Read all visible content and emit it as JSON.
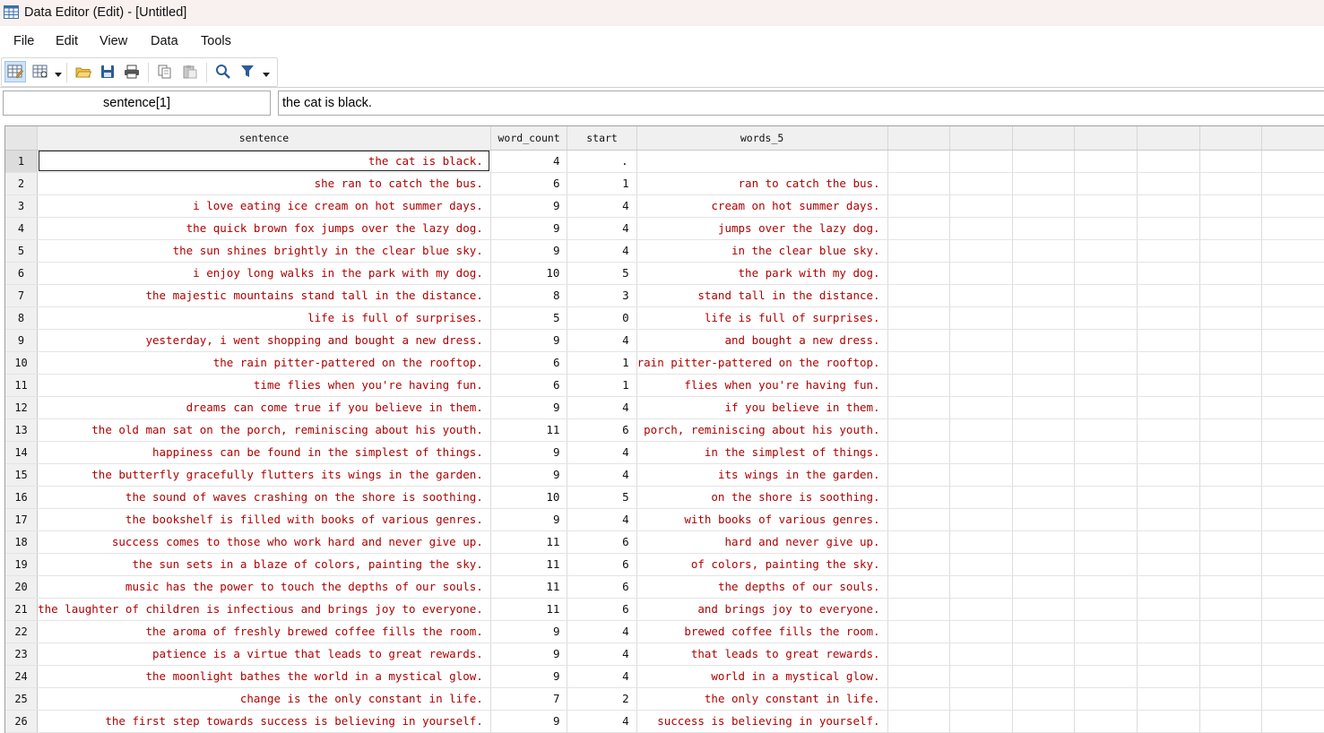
{
  "window": {
    "title": "Data Editor (Edit) - [Untitled]",
    "app_icon": "data-editor-grid-icon"
  },
  "menu": [
    "File",
    "Edit",
    "View",
    "Data",
    "Tools"
  ],
  "toolbar": {
    "buttons": [
      "edit-mode-icon",
      "browse-mode-icon",
      "open-icon",
      "save-icon",
      "print-icon",
      "copy-icon",
      "paste-icon",
      "find-icon",
      "filter-icon"
    ]
  },
  "refbar": {
    "cell_name": "sentence[1]",
    "cell_value": "the cat is black."
  },
  "colors": {
    "string_text": "#b00000",
    "title_bar": "#f9f1ef",
    "selection_outline": "#222222"
  },
  "grid": {
    "columns": [
      "sentence",
      "word_count",
      "start",
      "words_5",
      "",
      "",
      "",
      "",
      "",
      "",
      ""
    ],
    "selected_cell": {
      "row": 1,
      "column": "sentence"
    },
    "rows": [
      {
        "n": "1",
        "sentence": "the cat is black.",
        "word_count": "4",
        "start": ".",
        "words_5": ""
      },
      {
        "n": "2",
        "sentence": "she ran to catch the bus.",
        "word_count": "6",
        "start": "1",
        "words_5": "ran to catch the bus."
      },
      {
        "n": "3",
        "sentence": "i love eating ice cream on hot summer days.",
        "word_count": "9",
        "start": "4",
        "words_5": "cream on hot summer days."
      },
      {
        "n": "4",
        "sentence": "the quick brown fox jumps over the lazy dog.",
        "word_count": "9",
        "start": "4",
        "words_5": "jumps over the lazy dog."
      },
      {
        "n": "5",
        "sentence": "the sun shines brightly in the clear blue sky.",
        "word_count": "9",
        "start": "4",
        "words_5": "in the clear blue sky."
      },
      {
        "n": "6",
        "sentence": "i enjoy long walks in the park with my dog.",
        "word_count": "10",
        "start": "5",
        "words_5": "the park with my dog."
      },
      {
        "n": "7",
        "sentence": "the majestic mountains stand tall in the distance.",
        "word_count": "8",
        "start": "3",
        "words_5": "stand tall in the distance."
      },
      {
        "n": "8",
        "sentence": "life is full of surprises.",
        "word_count": "5",
        "start": "0",
        "words_5": "life is full of surprises."
      },
      {
        "n": "9",
        "sentence": "yesterday, i went shopping and bought a new dress.",
        "word_count": "9",
        "start": "4",
        "words_5": "and bought a new dress."
      },
      {
        "n": "10",
        "sentence": "the rain pitter-pattered on the rooftop.",
        "word_count": "6",
        "start": "1",
        "words_5": "rain pitter-pattered on the rooftop."
      },
      {
        "n": "11",
        "sentence": "time flies when you're having fun.",
        "word_count": "6",
        "start": "1",
        "words_5": "flies when you're having fun."
      },
      {
        "n": "12",
        "sentence": "dreams can come true if you believe in them.",
        "word_count": "9",
        "start": "4",
        "words_5": "if you believe in them."
      },
      {
        "n": "13",
        "sentence": "the old man sat on the porch, reminiscing about his youth.",
        "word_count": "11",
        "start": "6",
        "words_5": "porch, reminiscing about his youth."
      },
      {
        "n": "14",
        "sentence": "happiness can be found in the simplest of things.",
        "word_count": "9",
        "start": "4",
        "words_5": "in the simplest of things."
      },
      {
        "n": "15",
        "sentence": "the butterfly gracefully flutters its wings in the garden.",
        "word_count": "9",
        "start": "4",
        "words_5": "its wings in the garden."
      },
      {
        "n": "16",
        "sentence": "the sound of waves crashing on the shore is soothing.",
        "word_count": "10",
        "start": "5",
        "words_5": "on the shore is soothing."
      },
      {
        "n": "17",
        "sentence": "the bookshelf is filled with books of various genres.",
        "word_count": "9",
        "start": "4",
        "words_5": "with books of various genres."
      },
      {
        "n": "18",
        "sentence": "success comes to those who work hard and never give up.",
        "word_count": "11",
        "start": "6",
        "words_5": "hard and never give up."
      },
      {
        "n": "19",
        "sentence": "the sun sets in a blaze of colors, painting the sky.",
        "word_count": "11",
        "start": "6",
        "words_5": "of colors, painting the sky."
      },
      {
        "n": "20",
        "sentence": "music has the power to touch the depths of our souls.",
        "word_count": "11",
        "start": "6",
        "words_5": "the depths of our souls."
      },
      {
        "n": "21",
        "sentence": "the laughter of children is infectious and brings joy to everyone.",
        "word_count": "11",
        "start": "6",
        "words_5": "and brings joy to everyone."
      },
      {
        "n": "22",
        "sentence": "the aroma of freshly brewed coffee fills the room.",
        "word_count": "9",
        "start": "4",
        "words_5": "brewed coffee fills the room."
      },
      {
        "n": "23",
        "sentence": "patience is a virtue that leads to great rewards.",
        "word_count": "9",
        "start": "4",
        "words_5": "that leads to great rewards."
      },
      {
        "n": "24",
        "sentence": "the moonlight bathes the world in a mystical glow.",
        "word_count": "9",
        "start": "4",
        "words_5": "world in a mystical glow."
      },
      {
        "n": "25",
        "sentence": "change is the only constant in life.",
        "word_count": "7",
        "start": "2",
        "words_5": "the only constant in life."
      },
      {
        "n": "26",
        "sentence": "the first step towards success is believing in yourself.",
        "word_count": "9",
        "start": "4",
        "words_5": "success is believing in yourself."
      }
    ]
  }
}
